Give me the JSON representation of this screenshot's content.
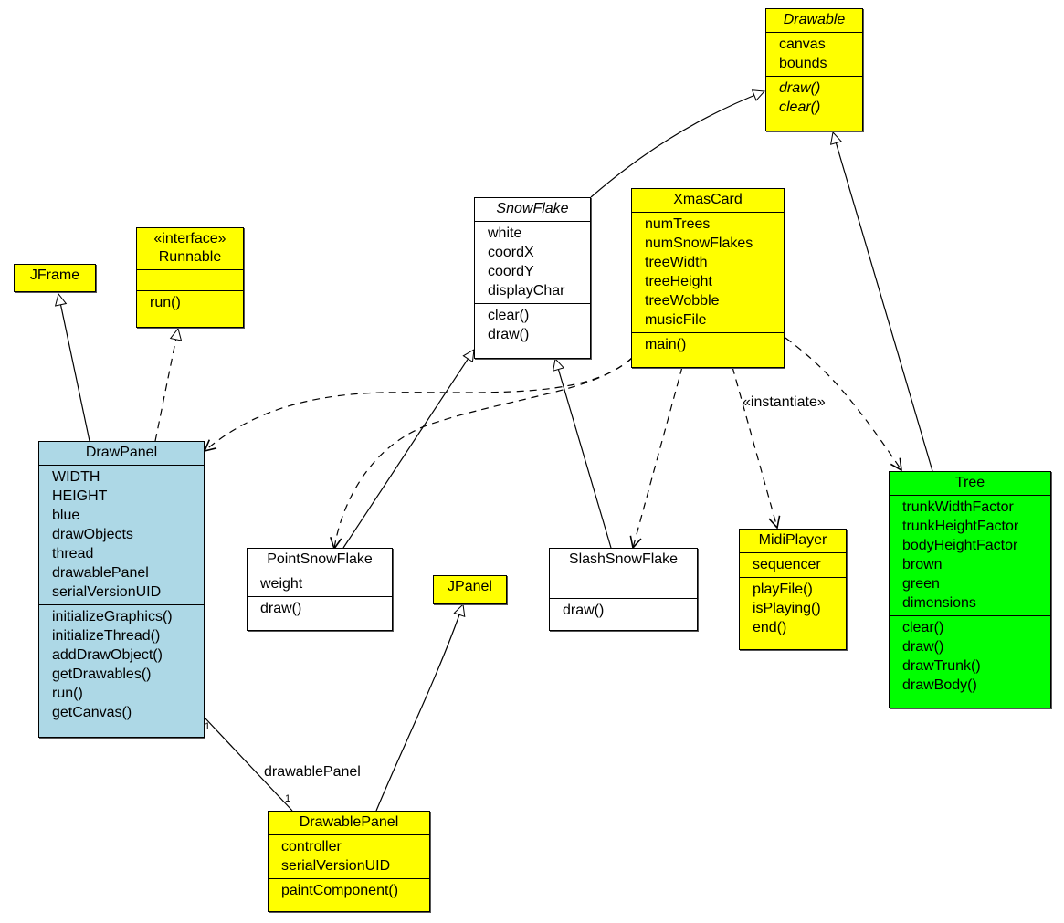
{
  "diagram": {
    "type": "UML class diagram",
    "classes": {
      "drawable": {
        "name": "Drawable",
        "abstract": true,
        "attributes": [
          "canvas",
          "bounds"
        ],
        "methods": [
          "draw()",
          "clear()"
        ],
        "color": "#ffff00"
      },
      "jframe": {
        "name": "JFrame",
        "color": "#ffff00"
      },
      "runnable": {
        "stereotype": "«interface»",
        "name": "Runnable",
        "attributes": [],
        "methods": [
          "run()"
        ],
        "color": "#ffff00"
      },
      "snowflake": {
        "name": "SnowFlake",
        "abstract": true,
        "attributes": [
          "white",
          "coordX",
          "coordY",
          "displayChar"
        ],
        "methods": [
          "clear()",
          "draw()"
        ],
        "color": "#ffffff"
      },
      "xmascard": {
        "name": "XmasCard",
        "attributes": [
          "numTrees",
          "numSnowFlakes",
          "treeWidth",
          "treeHeight",
          "treeWobble",
          "musicFile"
        ],
        "methods": [
          "main()"
        ],
        "color": "#ffff00"
      },
      "drawpanel": {
        "name": "DrawPanel",
        "attributes": [
          "WIDTH",
          "HEIGHT",
          "blue",
          "drawObjects",
          "thread",
          "drawablePanel",
          "serialVersionUID"
        ],
        "methods": [
          "initializeGraphics()",
          "initializeThread()",
          "addDrawObject()",
          "getDrawables()",
          "run()",
          "getCanvas()"
        ],
        "color": "#add8e6"
      },
      "pointsnowflake": {
        "name": "PointSnowFlake",
        "attributes": [
          "weight"
        ],
        "methods": [
          "draw()"
        ],
        "color": "#ffffff"
      },
      "jpanel": {
        "name": "JPanel",
        "color": "#ffff00"
      },
      "slashsnowflake": {
        "name": "SlashSnowFlake",
        "attributes": [],
        "methods": [
          "draw()"
        ],
        "color": "#ffffff"
      },
      "midiplayer": {
        "name": "MidiPlayer",
        "attributes": [
          "sequencer"
        ],
        "methods": [
          "playFile()",
          "isPlaying()",
          "end()"
        ],
        "color": "#ffff00"
      },
      "tree": {
        "name": "Tree",
        "attributes": [
          "trunkWidthFactor",
          "trunkHeightFactor",
          "bodyHeightFactor",
          "brown",
          "green",
          "dimensions"
        ],
        "methods": [
          "clear()",
          "draw()",
          "drawTrunk()",
          "drawBody()"
        ],
        "color": "#00ff00"
      },
      "drawablepanel": {
        "name": "DrawablePanel",
        "attributes": [
          "controller",
          "serialVersionUID"
        ],
        "methods": [
          "paintComponent()"
        ],
        "color": "#ffff00"
      }
    },
    "relationships": [
      {
        "from": "SnowFlake",
        "to": "Drawable",
        "kind": "generalization"
      },
      {
        "from": "Tree",
        "to": "Drawable",
        "kind": "generalization"
      },
      {
        "from": "DrawPanel",
        "to": "JFrame",
        "kind": "generalization"
      },
      {
        "from": "DrawPanel",
        "to": "Runnable",
        "kind": "realization"
      },
      {
        "from": "PointSnowFlake",
        "to": "SnowFlake",
        "kind": "generalization"
      },
      {
        "from": "SlashSnowFlake",
        "to": "SnowFlake",
        "kind": "generalization"
      },
      {
        "from": "DrawablePanel",
        "to": "JPanel",
        "kind": "generalization"
      },
      {
        "from": "XmasCard",
        "to": "DrawPanel",
        "kind": "dependency"
      },
      {
        "from": "XmasCard",
        "to": "PointSnowFlake",
        "kind": "dependency"
      },
      {
        "from": "XmasCard",
        "to": "SlashSnowFlake",
        "kind": "dependency"
      },
      {
        "from": "XmasCard",
        "to": "MidiPlayer",
        "kind": "dependency",
        "label": "«instantiate»"
      },
      {
        "from": "XmasCard",
        "to": "Tree",
        "kind": "dependency"
      },
      {
        "from": "DrawPanel",
        "to": "DrawablePanel",
        "kind": "association",
        "label": "drawablePanel",
        "source_multiplicity": "1",
        "target_multiplicity": "1"
      }
    ],
    "labels": {
      "instantiate": "«instantiate»",
      "drawable_panel_role": "drawablePanel",
      "mult_drawpanel": "1",
      "mult_drawablepanel": "1"
    }
  }
}
